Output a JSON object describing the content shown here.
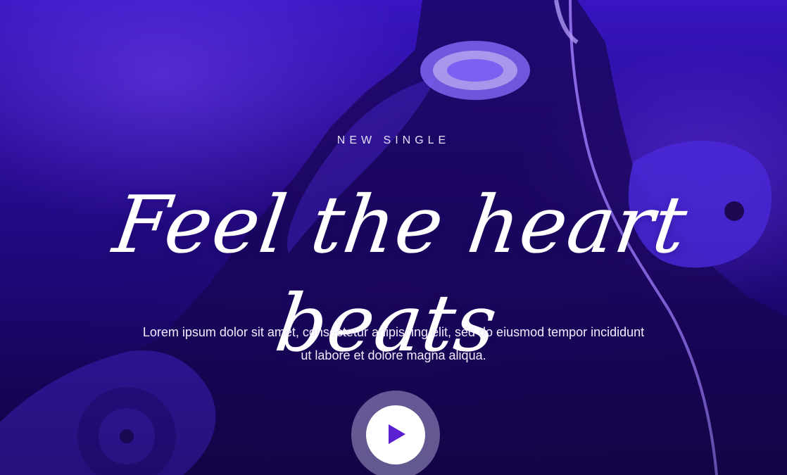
{
  "hero": {
    "eyebrow": "NEW SINGLE",
    "headline": "Feel the heart beats",
    "description": "Lorem ipsum dolor sit amet, consectetur adipiscing elit, sed do eiusmod tempor incididunt ut labore et dolore magna aliqua.",
    "play_icon": "play-icon"
  },
  "colors": {
    "background_top": "#3a16c8",
    "background_bottom": "#13044d",
    "accent": "#5a1fd1",
    "text": "#ffffff"
  }
}
